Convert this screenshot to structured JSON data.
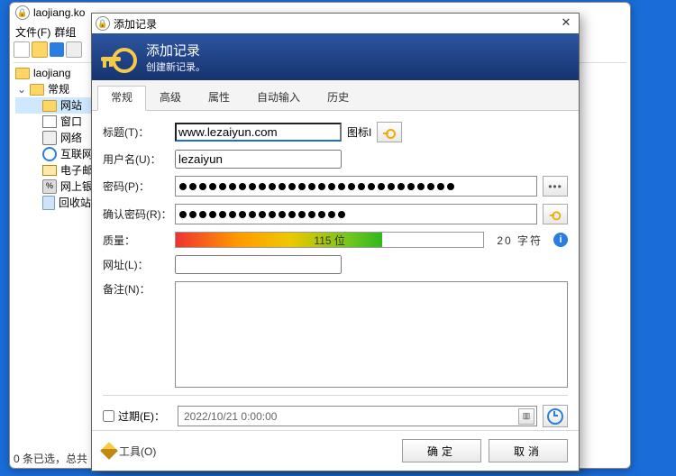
{
  "main": {
    "title": "laojiang.ko",
    "menu": {
      "file": "文件(F)",
      "group": "群组"
    },
    "tree": {
      "root": "laojiang",
      "general": "常规",
      "items": [
        "网站",
        "窗口",
        "网络",
        "互联网",
        "电子邮件",
        "网上银行",
        "回收站"
      ]
    },
    "status": "0 条已选，总共"
  },
  "dlg": {
    "title": "添加记录",
    "banner": {
      "title": "添加记录",
      "subtitle": "创建新记录。"
    },
    "tabs": [
      "常规",
      "高级",
      "属性",
      "自动输入",
      "历史"
    ],
    "labels": {
      "title": "标题(T)：",
      "icon": "图标I",
      "user": "用户名(U)：",
      "pwd": "密码(P)：",
      "pwd2": "确认密码(R)：",
      "quality": "质量：",
      "url": "网址(L)：",
      "notes": "备注(N)：",
      "expire": "过期(E)："
    },
    "values": {
      "title": "www.lezaiyun.com",
      "user": "lezaiyun",
      "pwd_dots": 28,
      "pwd2_dots": 17,
      "quality_bits": "115 位",
      "quality_chars": "20 字符",
      "url": "",
      "notes": "",
      "expire": "2022/10/21  0:00:00"
    },
    "footer": {
      "tools": "工具(O)",
      "ok": "确定",
      "cancel": "取消"
    }
  }
}
